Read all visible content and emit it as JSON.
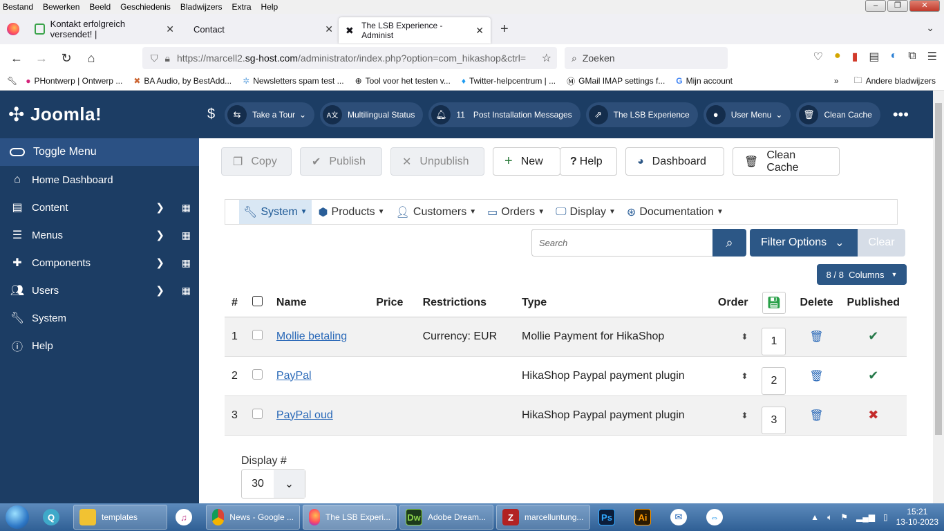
{
  "menubar": [
    "Bestand",
    "Bewerken",
    "Beeld",
    "Geschiedenis",
    "Bladwijzers",
    "Extra",
    "Help"
  ],
  "tabs": [
    {
      "label": "Kontakt erfolgreich versendet! |"
    },
    {
      "label": "Contact"
    },
    {
      "label": "The LSB Experience - Administ"
    }
  ],
  "url": {
    "prefix": "https://marcell2.",
    "host": "sg-host.com",
    "path": "/administrator/index.php?option=com_hikashop&ctrl="
  },
  "search_placeholder": "Zoeken",
  "bookmarks": [
    "PHontwerp | Ontwerp ...",
    "BA Audio, by BestAdd...",
    "Newsletters spam test ...",
    "Tool voor het testen v...",
    "Twitter-helpcentrum | ...",
    "GMail IMAP settings f...",
    "Mijn account"
  ],
  "bookmarks_other": "Andere bladwijzers",
  "sidebar": {
    "logo": "Joomla!",
    "toggle": "Toggle Menu",
    "items": [
      {
        "label": "Home Dashboard",
        "icon": "home-icon"
      },
      {
        "label": "Content",
        "icon": "file-icon"
      },
      {
        "label": "Menus",
        "icon": "list-icon"
      },
      {
        "label": "Components",
        "icon": "puzzle-icon"
      },
      {
        "label": "Users",
        "icon": "users-icon"
      },
      {
        "label": "System",
        "icon": "wrench-icon"
      },
      {
        "label": "Help",
        "icon": "info-icon"
      }
    ]
  },
  "header": {
    "take_tour": "Take a Tour",
    "multilingual": "Multilingual Status",
    "post_count": "11",
    "post_install": "Post Installation Messages",
    "site": "The LSB Experience",
    "user_menu": "User Menu",
    "clean_cache": "Clean Cache"
  },
  "toolbar": {
    "copy": "Copy",
    "publish": "Publish",
    "unpublish": "Unpublish",
    "new": "New",
    "help": "Help",
    "dashboard": "Dashboard",
    "clean_cache": "Clean Cache"
  },
  "hikamenu": [
    "System",
    "Products",
    "Customers",
    "Orders",
    "Display",
    "Documentation"
  ],
  "filters": {
    "search_placeholder": "Search",
    "filter_options": "Filter Options",
    "clear": "Clear",
    "columns": "8 / 8  Columns"
  },
  "table": {
    "headers": [
      "#",
      "Name",
      "Price",
      "Restrictions",
      "Type",
      "Order",
      "Delete",
      "Published"
    ],
    "rows": [
      {
        "num": "1",
        "name": "Mollie betaling",
        "price": "",
        "restrictions": "Currency: EUR",
        "type": "Mollie Payment for HikaShop",
        "order": "1",
        "published": true
      },
      {
        "num": "2",
        "name": "PayPal",
        "price": "",
        "restrictions": "",
        "type": "HikaShop Paypal payment plugin",
        "order": "2",
        "published": true
      },
      {
        "num": "3",
        "name": "PayPal oud",
        "price": "",
        "restrictions": "",
        "type": "HikaShop Paypal payment plugin",
        "order": "3",
        "published": false
      }
    ]
  },
  "display": {
    "label": "Display #",
    "value": "30"
  },
  "taskbar": {
    "items": [
      "templates",
      "News - Google ...",
      "The LSB Experi...",
      "Adobe Dream...",
      "marcelluntung..."
    ],
    "time": "15:21",
    "date": "13-10-2023"
  }
}
